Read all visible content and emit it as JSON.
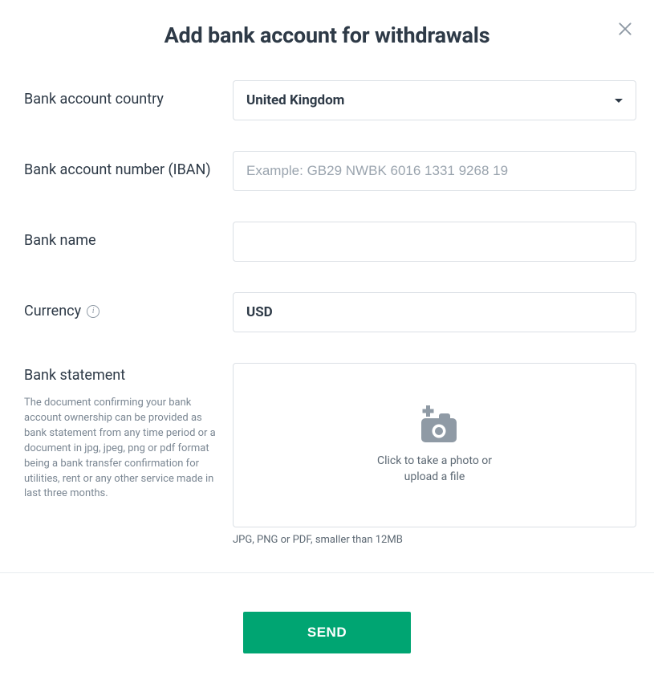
{
  "modal": {
    "title": "Add bank account for withdrawals"
  },
  "fields": {
    "country": {
      "label": "Bank account country",
      "value": "United Kingdom"
    },
    "iban": {
      "label": "Bank account number (IBAN)",
      "placeholder": "Example: GB29 NWBK 6016 1331 9268 19",
      "value": ""
    },
    "bankName": {
      "label": "Bank name",
      "value": ""
    },
    "currency": {
      "label": "Currency",
      "value": "USD"
    },
    "statement": {
      "label": "Bank statement",
      "help": "The document confirming your bank account ownership can be provided as bank statement from any time period or a document in jpg, jpeg, png or pdf format being a bank transfer confirmation for utilities, rent or any other service made in last three months.",
      "uploadLine1": "Click to take a photo or",
      "uploadLine2": "upload a file",
      "hint": "JPG, PNG or PDF, smaller than 12MB"
    }
  },
  "actions": {
    "send": "SEND"
  }
}
